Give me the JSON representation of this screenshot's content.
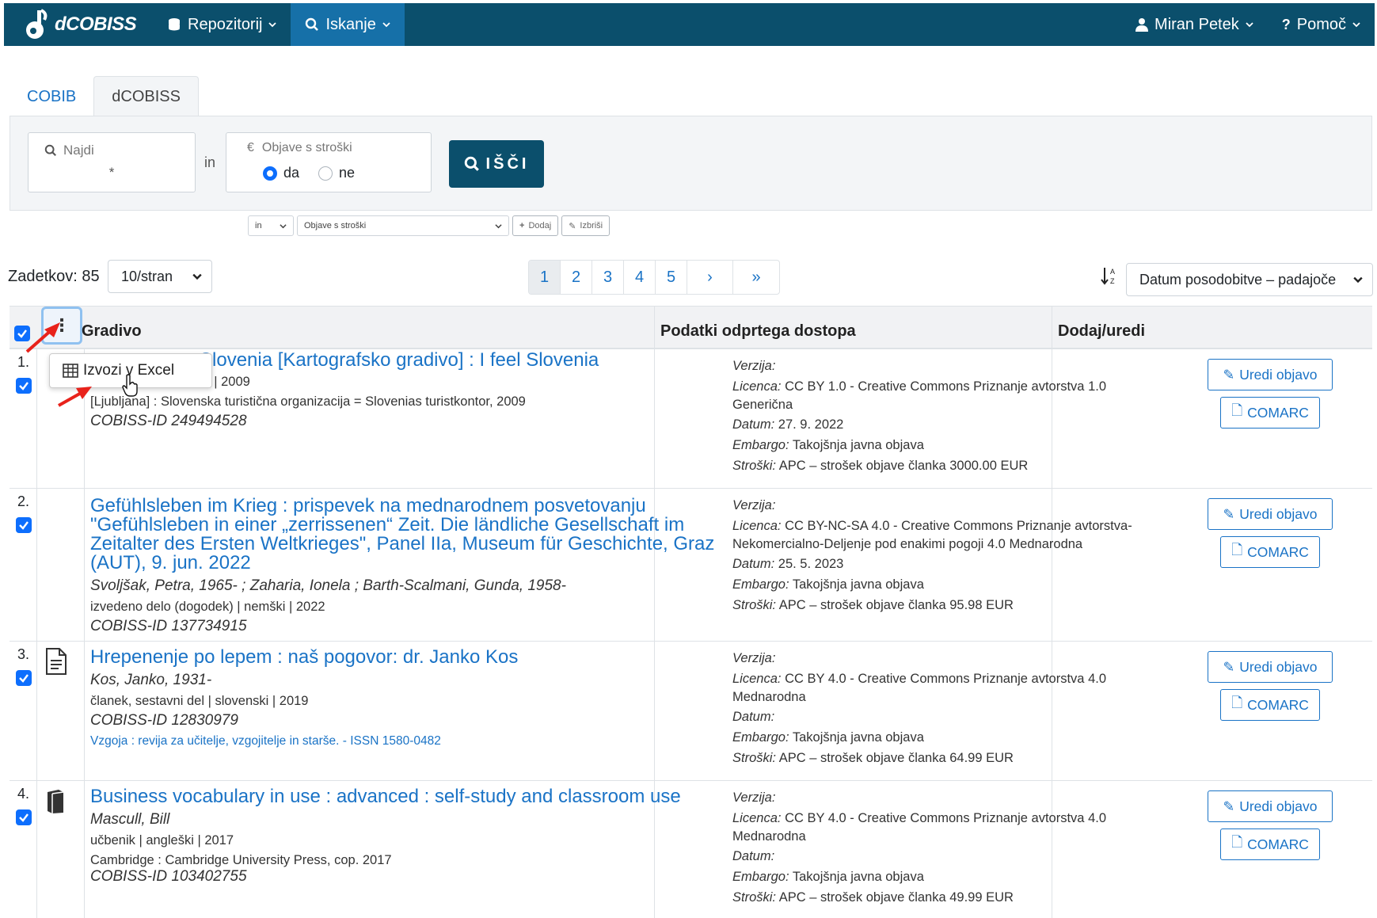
{
  "navbar": {
    "brand": "dCOBISS",
    "menu": [
      {
        "label": "Repozitorij",
        "icon": "database-icon"
      },
      {
        "label": "Iskanje",
        "icon": "search-icon",
        "active": true
      }
    ],
    "user": "Miran Petek",
    "help": "Pomoč"
  },
  "tabs": [
    {
      "label": "COBIB"
    },
    {
      "label": "dCOBISS",
      "active": true
    }
  ],
  "search": {
    "find_label": "Najdi",
    "find_value": "*",
    "in_label": "in",
    "cost_label": "Objave s stroški",
    "cost_currency": "€",
    "radio_yes": "da",
    "radio_no": "ne",
    "radio_selected": "da",
    "button": "IŠČI"
  },
  "advanced": {
    "operator": "in",
    "field": "Objave s stroški",
    "add": "Dodaj",
    "remove": "Izbriši"
  },
  "results": {
    "hits_label": "Zadetkov: 85",
    "per_page": "10/stran",
    "pages": [
      "1",
      "2",
      "3",
      "4",
      "5",
      "›",
      "»"
    ],
    "current_page": "1",
    "sort": "Datum posodobitve – padajoče"
  },
  "table": {
    "col_material": "Gradivo",
    "col_oa": "Podatki odprtega dostopa",
    "col_actions": "Dodaj/uredi",
    "rows": [
      {
        "num": "1.",
        "title": "Slovenia [Kartografsko gradivo] : I feel Slovenia",
        "meta": "zemljevid, načrt, slovenski | 2009",
        "meta_visible": "i | 2009",
        "publisher": "[Ljubljana] : Slovenska turistična organizacija = Slovenias turistkontor, 2009",
        "cobiss_id": "COBISS-ID 249494528",
        "oa": {
          "version": "",
          "licence": "CC BY 1.0 - Creative Commons Priznanje avtorstva 1.0 Generična",
          "date": "27. 9. 2022",
          "embargo": "Takojšnja javna objava",
          "cost": "APC – strošek objave članka 3000.00 EUR"
        }
      },
      {
        "num": "2.",
        "title": "Gefühlsleben im Krieg : prispevek na mednarodnem posvetovanju \"Gefühlsleben in einer „zerrissenen“ Zeit. Die ländliche Gesellschaft im Zeitalter des Ersten Weltkrieges\", Panel IIa, Museum für Geschichte, Graz (AUT), 9. jun. 2022",
        "authors": "Svoljšak, Petra, 1965- ; Zaharia, Ionela ; Barth-Scalmani, Gunda, 1958-",
        "meta": "izvedeno delo (dogodek) | nemški | 2022",
        "cobiss_id": "COBISS-ID 137734915",
        "oa": {
          "version": "",
          "licence": "CC BY-NC-SA 4.0 - Creative Commons Priznanje avtorstva-Nekomercialno-Deljenje pod enakimi pogoji 4.0 Mednarodna",
          "date": "25. 5. 2023",
          "embargo": "Takojšnja javna objava",
          "cost": "APC – strošek objave članka 95.98 EUR"
        }
      },
      {
        "num": "3.",
        "title": "Hrepenenje po lepem : naš pogovor: dr. Janko Kos",
        "authors": "Kos, Janko, 1931-",
        "meta": "članek, sestavni del | slovenski | 2019",
        "cobiss_id": "COBISS-ID 12830979",
        "issn": "Vzgoja : revija za učitelje, vzgojitelje in starše. - ISSN 1580-0482",
        "oa": {
          "version": "",
          "licence": "CC BY 4.0 - Creative Commons Priznanje avtorstva 4.0 Mednarodna",
          "date": "",
          "embargo": "Takojšnja javna objava",
          "cost": "APC – strošek objave članka 64.99 EUR"
        }
      },
      {
        "num": "4.",
        "title": "Business vocabulary in use : advanced : self-study and classroom use",
        "authors": "Mascull, Bill",
        "meta": "učbenik | angleški | 2017",
        "publisher": "Cambridge : Cambridge University Press, cop. 2017",
        "cobiss_id": "COBISS-ID 103402755",
        "oa": {
          "version": "",
          "licence": "CC BY 4.0 - Creative Commons Priznanje avtorstva 4.0 Mednarodna",
          "date": "",
          "embargo": "Takojšnja javna objava",
          "cost": "APC – strošek objave članka 49.99 EUR"
        }
      }
    ],
    "oa_labels": {
      "version": "Verzija:",
      "licence": "Licenca:",
      "date": "Datum:",
      "embargo": "Embargo:",
      "cost": "Stroški:"
    },
    "edit_button": "Uredi objavo",
    "comarc_button": "COMARC"
  },
  "dropdown": {
    "item": "Izvozi v Excel"
  },
  "colors": {
    "navbar": "#0b4f6c",
    "nav_active": "#1670a8",
    "link": "#1a73c6",
    "checkbox": "#0d6efd",
    "annotation_arrow": "#e8221b"
  }
}
